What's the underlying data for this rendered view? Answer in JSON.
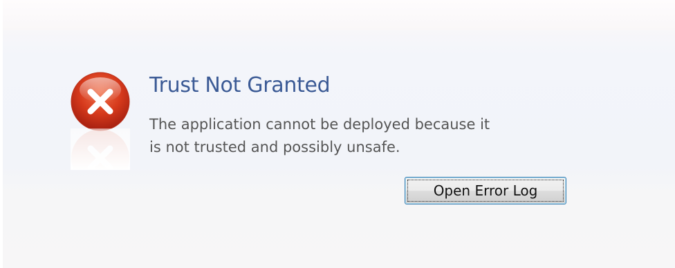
{
  "dialog": {
    "title": "Trust Not Granted",
    "message_line1": "The application cannot be deployed because it",
    "message_line2": "is not trusted and possibly unsafe.",
    "open_log_label": "Open Error Log",
    "icon": "error-x-icon"
  },
  "colors": {
    "title": "#3b5a95",
    "message": "#555555",
    "icon_red": "#d13b1e",
    "button_border": "#3c7fb1"
  }
}
